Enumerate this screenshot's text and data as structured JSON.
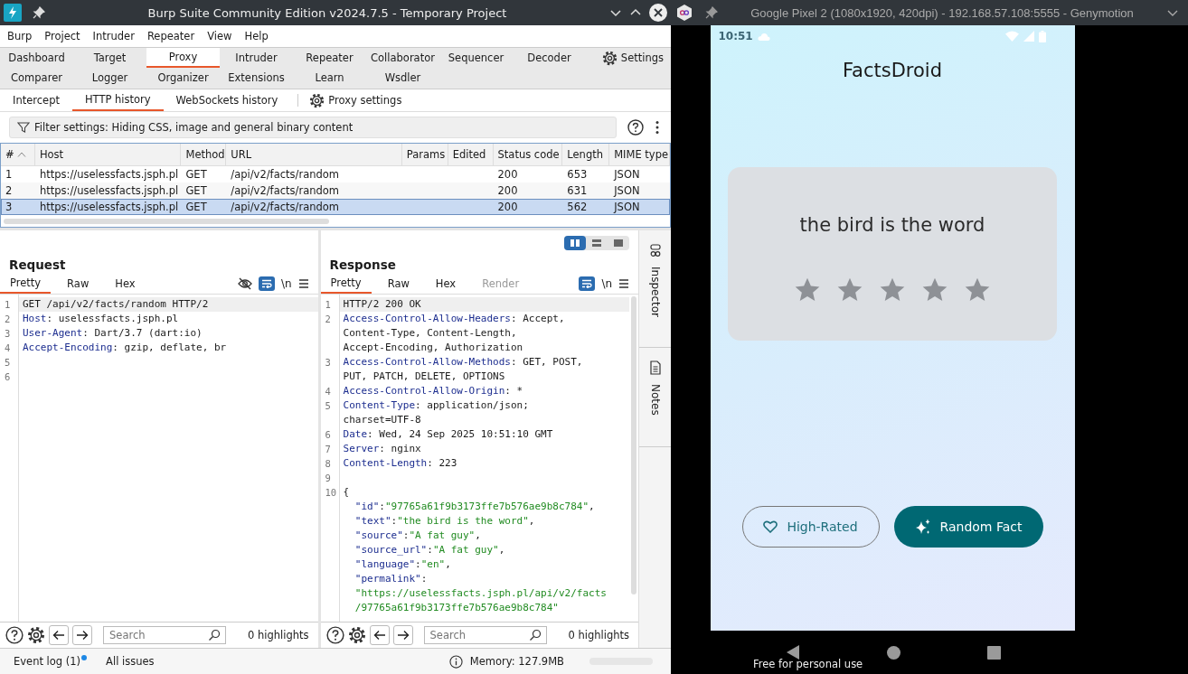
{
  "burp_window": {
    "title": "Burp Suite Community Edition v2024.7.5 - Temporary Project",
    "menu": [
      "Burp",
      "Project",
      "Intruder",
      "Repeater",
      "View",
      "Help"
    ],
    "tab_rows": [
      {
        "tabs": [
          {
            "label": "Dashboard",
            "selected": false
          },
          {
            "label": "Target",
            "selected": false
          },
          {
            "label": "Proxy",
            "selected": true
          },
          {
            "label": "Intruder",
            "selected": false
          },
          {
            "label": "Repeater",
            "selected": false
          },
          {
            "label": "Collaborator",
            "selected": false
          },
          {
            "label": "Sequencer",
            "selected": false
          },
          {
            "label": "Decoder",
            "selected": false
          }
        ]
      },
      {
        "tabs": [
          {
            "label": "Comparer",
            "selected": false
          },
          {
            "label": "Logger",
            "selected": false
          },
          {
            "label": "Organizer",
            "selected": false
          },
          {
            "label": "Extensions",
            "selected": false
          },
          {
            "label": "Learn",
            "selected": false
          },
          {
            "label": "Wsdler",
            "selected": false
          }
        ]
      }
    ],
    "settings_button": "Settings",
    "proxy_tabs": [
      {
        "label": "Intercept",
        "selected": false
      },
      {
        "label": "HTTP history",
        "selected": true
      },
      {
        "label": "WebSockets history",
        "selected": false
      }
    ],
    "proxy_settings": "Proxy settings",
    "filter": "Filter settings: Hiding CSS, image and general binary content",
    "table": {
      "columns": [
        {
          "label": "#",
          "sorted": true
        },
        {
          "label": "Host",
          "sorted": false
        },
        {
          "label": "Method",
          "sorted": false
        },
        {
          "label": "URL",
          "sorted": false
        },
        {
          "label": "Params",
          "sorted": false
        },
        {
          "label": "Edited",
          "sorted": false
        },
        {
          "label": "Status code",
          "sorted": false
        },
        {
          "label": "Length",
          "sorted": false
        },
        {
          "label": "MIME type",
          "sorted": false
        }
      ],
      "rows": [
        {
          "selected": false,
          "cells": [
            "1",
            "https://uselessfacts.jsph.pl",
            "GET",
            "/api/v2/facts/random",
            "",
            "",
            "200",
            "653",
            "JSON"
          ]
        },
        {
          "selected": false,
          "cells": [
            "2",
            "https://uselessfacts.jsph.pl",
            "GET",
            "/api/v2/facts/random",
            "",
            "",
            "200",
            "631",
            "JSON"
          ]
        },
        {
          "selected": true,
          "cells": [
            "3",
            "https://uselessfacts.jsph.pl",
            "GET",
            "/api/v2/facts/random",
            "",
            "",
            "200",
            "562",
            "JSON"
          ]
        }
      ]
    },
    "layout_toggles": [
      {
        "kind": "side-by-side",
        "selected": true
      },
      {
        "kind": "stacked",
        "selected": false
      },
      {
        "kind": "single",
        "selected": false
      }
    ],
    "panes": [
      {
        "title": "Request",
        "hide_toggle": true,
        "wrap_on": true,
        "newline_toggle": "\\n",
        "tabs": [
          {
            "label": "Pretty",
            "selected": true,
            "disabled": false
          },
          {
            "label": "Raw",
            "selected": false,
            "disabled": false
          },
          {
            "label": "Hex",
            "selected": false,
            "disabled": false
          }
        ],
        "lines": [
          {
            "number": "1",
            "segments": [
              {
                "kind": "plain",
                "text": "GET /api/v2/facts/random HTTP/2"
              }
            ]
          },
          {
            "number": "2",
            "segments": [
              {
                "kind": "key",
                "text": "Host"
              },
              {
                "kind": "plain",
                "text": ": uselessfacts.jsph.pl"
              }
            ]
          },
          {
            "number": "3",
            "segments": [
              {
                "kind": "key",
                "text": "User-Agent"
              },
              {
                "kind": "plain",
                "text": ": Dart/3.7 (dart:io)"
              }
            ]
          },
          {
            "number": "4",
            "segments": [
              {
                "kind": "key",
                "text": "Accept-Encoding"
              },
              {
                "kind": "plain",
                "text": ": gzip, deflate, br"
              }
            ]
          },
          {
            "number": "5"
          },
          {
            "number": "6"
          }
        ],
        "search": {
          "placeholder": "Search"
        },
        "highlights": "0 highlights"
      },
      {
        "title": "Response",
        "hide_toggle": false,
        "wrap_on": true,
        "newline_toggle": "\\n",
        "tabs": [
          {
            "label": "Pretty",
            "selected": true,
            "disabled": false
          },
          {
            "label": "Raw",
            "selected": false,
            "disabled": false
          },
          {
            "label": "Hex",
            "selected": false,
            "disabled": false
          },
          {
            "label": "Render",
            "selected": false,
            "disabled": true
          }
        ],
        "lines": [
          {
            "number": "1",
            "segments": [
              {
                "kind": "plain",
                "text": "HTTP/2 200 OK"
              }
            ]
          },
          {
            "number": "2",
            "segments": [
              {
                "kind": "key",
                "text": "Access-Control-Allow-Headers"
              },
              {
                "kind": "plain",
                "text": ": Accept,"
              }
            ]
          },
          {
            "segments": [
              {
                "kind": "plain",
                "text": "Content-Type, Content-Length,"
              }
            ]
          },
          {
            "segments": [
              {
                "kind": "plain",
                "text": "Accept-Encoding, Authorization"
              }
            ]
          },
          {
            "number": "3",
            "segments": [
              {
                "kind": "key",
                "text": "Access-Control-Allow-Methods"
              },
              {
                "kind": "plain",
                "text": ": GET, POST,"
              }
            ]
          },
          {
            "segments": [
              {
                "kind": "plain",
                "text": "PUT, PATCH, DELETE, OPTIONS"
              }
            ]
          },
          {
            "number": "4",
            "segments": [
              {
                "kind": "key",
                "text": "Access-Control-Allow-Origin"
              },
              {
                "kind": "plain",
                "text": ": *"
              }
            ]
          },
          {
            "number": "5",
            "segments": [
              {
                "kind": "key",
                "text": "Content-Type"
              },
              {
                "kind": "plain",
                "text": ": application/json;"
              }
            ]
          },
          {
            "segments": [
              {
                "kind": "plain",
                "text": "charset=UTF-8"
              }
            ]
          },
          {
            "number": "6",
            "segments": [
              {
                "kind": "key",
                "text": "Date"
              },
              {
                "kind": "plain",
                "text": ": Wed, 24 Sep 2025 10:51:10 GMT"
              }
            ]
          },
          {
            "number": "7",
            "segments": [
              {
                "kind": "key",
                "text": "Server"
              },
              {
                "kind": "plain",
                "text": ": nginx"
              }
            ]
          },
          {
            "number": "8",
            "segments": [
              {
                "kind": "key",
                "text": "Content-Length"
              },
              {
                "kind": "plain",
                "text": ": 223"
              }
            ]
          },
          {
            "number": "9"
          },
          {
            "number": "10",
            "segments": [
              {
                "kind": "plain",
                "text": "{"
              }
            ]
          },
          {
            "segments": [
              {
                "kind": "key",
                "text": "  \"id\""
              },
              {
                "kind": "plain",
                "text": ":"
              },
              {
                "kind": "string",
                "text": "\"97765a61f9b3173ffe7b576ae9b8c784\""
              },
              {
                "kind": "plain",
                "text": ","
              }
            ]
          },
          {
            "segments": [
              {
                "kind": "key",
                "text": "  \"text\""
              },
              {
                "kind": "plain",
                "text": ":"
              },
              {
                "kind": "string",
                "text": "\"the bird is the word\""
              },
              {
                "kind": "plain",
                "text": ","
              }
            ]
          },
          {
            "segments": [
              {
                "kind": "key",
                "text": "  \"source\""
              },
              {
                "kind": "plain",
                "text": ":"
              },
              {
                "kind": "string",
                "text": "\"A fat guy\""
              },
              {
                "kind": "plain",
                "text": ","
              }
            ]
          },
          {
            "segments": [
              {
                "kind": "key",
                "text": "  \"source_url\""
              },
              {
                "kind": "plain",
                "text": ":"
              },
              {
                "kind": "string",
                "text": "\"A fat guy\""
              },
              {
                "kind": "plain",
                "text": ","
              }
            ]
          },
          {
            "segments": [
              {
                "kind": "key",
                "text": "  \"language\""
              },
              {
                "kind": "plain",
                "text": ":"
              },
              {
                "kind": "string",
                "text": "\"en\""
              },
              {
                "kind": "plain",
                "text": ","
              }
            ]
          },
          {
            "segments": [
              {
                "kind": "key",
                "text": "  \"permalink\""
              },
              {
                "kind": "plain",
                "text": ":"
              }
            ]
          },
          {
            "segments": [
              {
                "kind": "string",
                "text": "  \"https://uselessfacts.jsph.pl/api/v2/facts"
              }
            ]
          },
          {
            "segments": [
              {
                "kind": "string",
                "text": "  /97765a61f9b3173ffe7b576ae9b8c784\""
              }
            ]
          }
        ],
        "search": {
          "placeholder": "Search"
        },
        "highlights": "0 highlights"
      }
    ],
    "side_panel": [
      "Inspector",
      "Notes"
    ],
    "status_bar": {
      "event_log": "Event log (1)",
      "unread": true,
      "all_issues": "All issues",
      "memory": "Memory: 127.9MB"
    }
  },
  "emulator_window": {
    "title": "Google Pixel 2 (1080x1920, 420dpi) - 192.168.57.108:5555 - Genymotion",
    "time": "10:51",
    "app_title": "FactsDroid",
    "fact": {
      "text": "the bird is the word",
      "stars": 0
    },
    "buttons": [
      {
        "label": "High-Rated",
        "kind": "outline"
      },
      {
        "label": "Random Fact",
        "kind": "filled"
      }
    ],
    "license_notice": "Free for personal use"
  }
}
